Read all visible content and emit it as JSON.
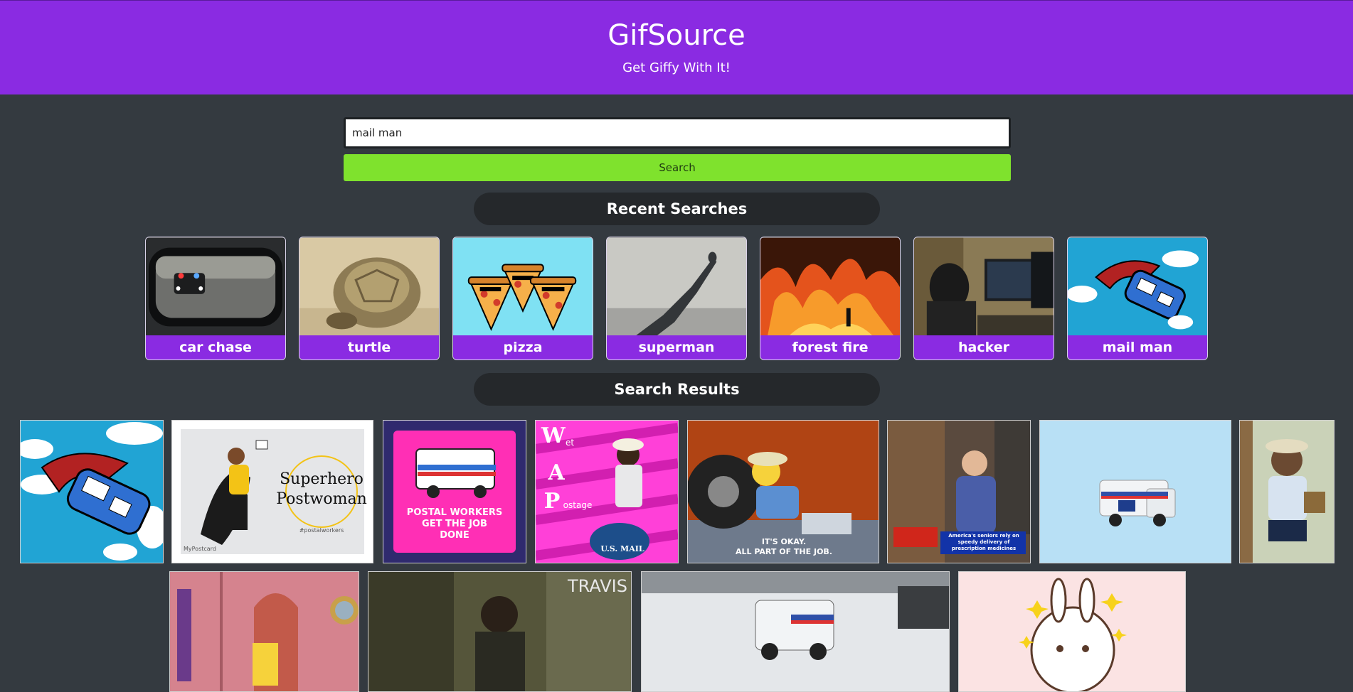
{
  "header": {
    "title": "GifSource",
    "subtitle": "Get Giffy With It!"
  },
  "search": {
    "value": "mail man",
    "button_label": "Search"
  },
  "recent": {
    "heading": "Recent Searches",
    "items": [
      {
        "label": "car chase"
      },
      {
        "label": "turtle"
      },
      {
        "label": "pizza"
      },
      {
        "label": "superman"
      },
      {
        "label": "forest fire"
      },
      {
        "label": "hacker"
      },
      {
        "label": "mail man"
      }
    ]
  },
  "results": {
    "heading": "Search Results",
    "texts": {
      "superhero_line1": "Superhero",
      "superhero_line2": "Postwoman",
      "superhero_tag": "#postalworkers",
      "superhero_brand": "MyPostcard",
      "stamp_line1": "POSTAL WORKERS",
      "stamp_line2": "GET THE JOB",
      "stamp_line3": "DONE",
      "wap_w": "W",
      "wap_et": "et",
      "wap_a": "A",
      "wap_p": "P",
      "wap_ostage": "ostage",
      "wap_bag": "U.S. MAIL",
      "simpsons_line1": "IT'S OKAY.",
      "simpsons_line2": "ALL PART OF THE JOB.",
      "news_caption": "America's seniors rely on speedy delivery of prescription medicines",
      "travis_logo": "TRAVIS"
    }
  },
  "colors": {
    "accent": "#8a2be2",
    "button": "#7fe22d",
    "background": "#343a40"
  }
}
